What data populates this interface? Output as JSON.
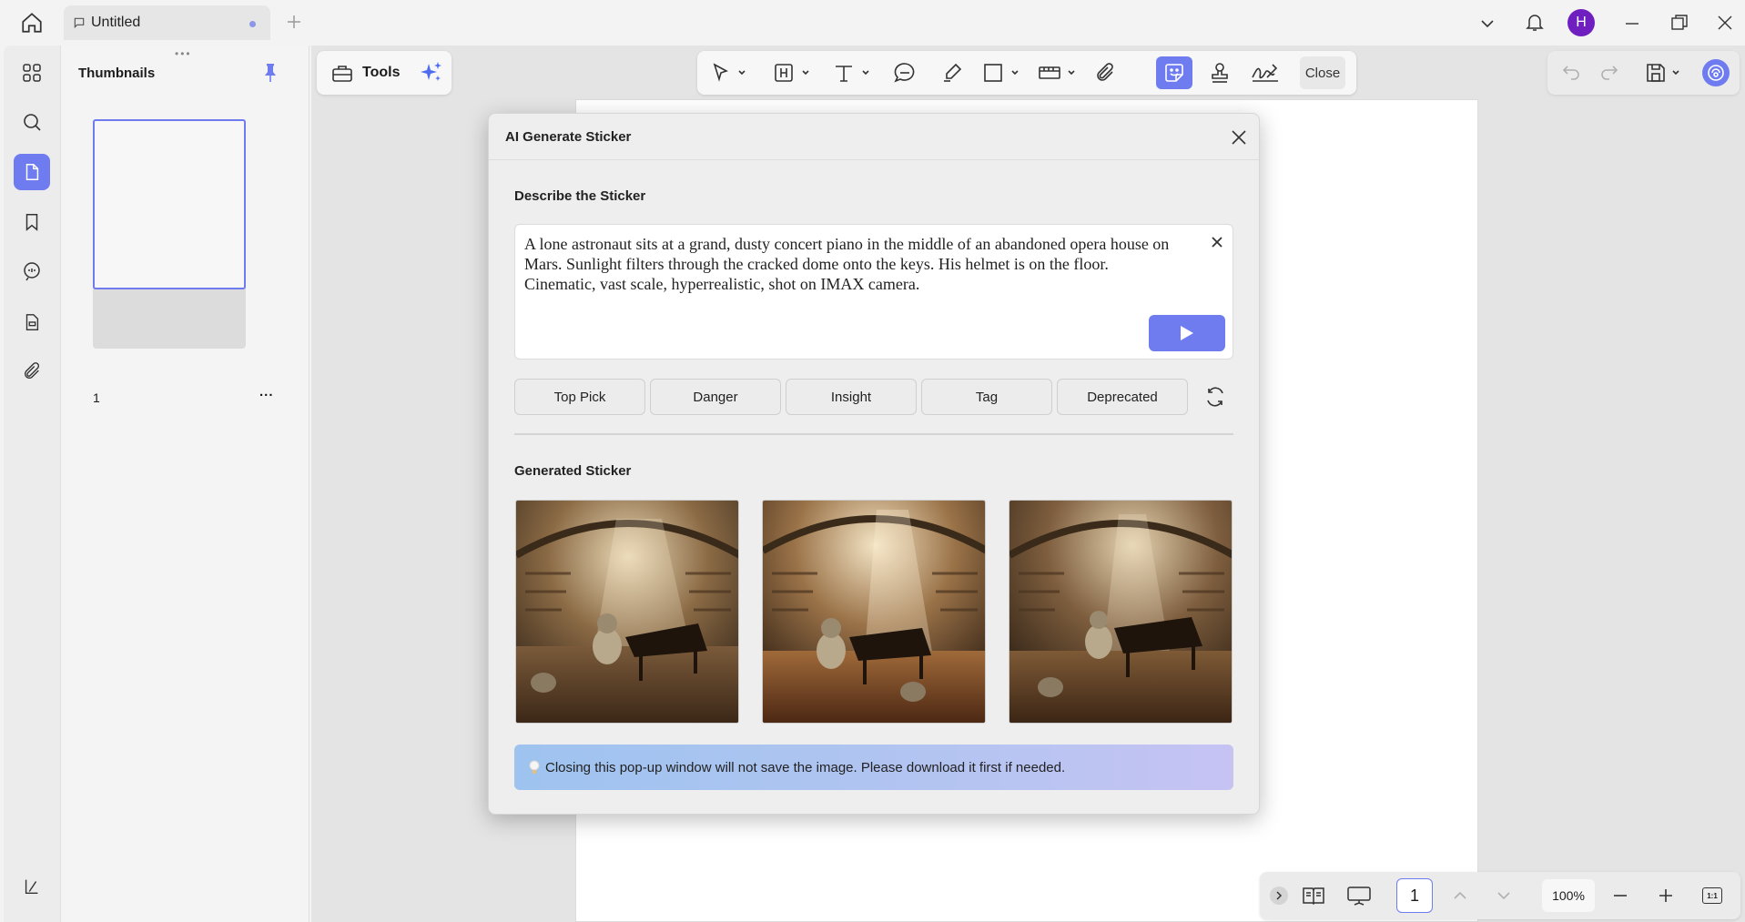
{
  "tab": {
    "title": "Untitled"
  },
  "window": {
    "avatar_initial": "H",
    "accent": "#6e7cf0",
    "avatar_color": "#6f1fbf"
  },
  "panel": {
    "title": "Thumbnails",
    "page_number": "1",
    "more": "..."
  },
  "tools": {
    "label": "Tools"
  },
  "toolbar": {
    "close_label": "Close"
  },
  "dialog": {
    "title": "AI Generate Sticker",
    "describe_label": "Describe the Sticker",
    "prompt": "A lone astronaut sits at a grand, dusty concert piano in the middle of an abandoned opera house on Mars. Sunlight filters through the cracked dome onto the keys. His helmet is on the floor. Cinematic, vast scale, hyperrealistic, shot on IMAX camera.",
    "chips": [
      "Top Pick",
      "Danger",
      "Insight",
      "Tag",
      "Deprecated"
    ],
    "generated_label": "Generated Sticker",
    "notice": "Closing this pop-up window will not save the image. Please download it first if needed."
  },
  "statusbar": {
    "page": "1",
    "zoom": "100%",
    "fit": "1:1"
  }
}
